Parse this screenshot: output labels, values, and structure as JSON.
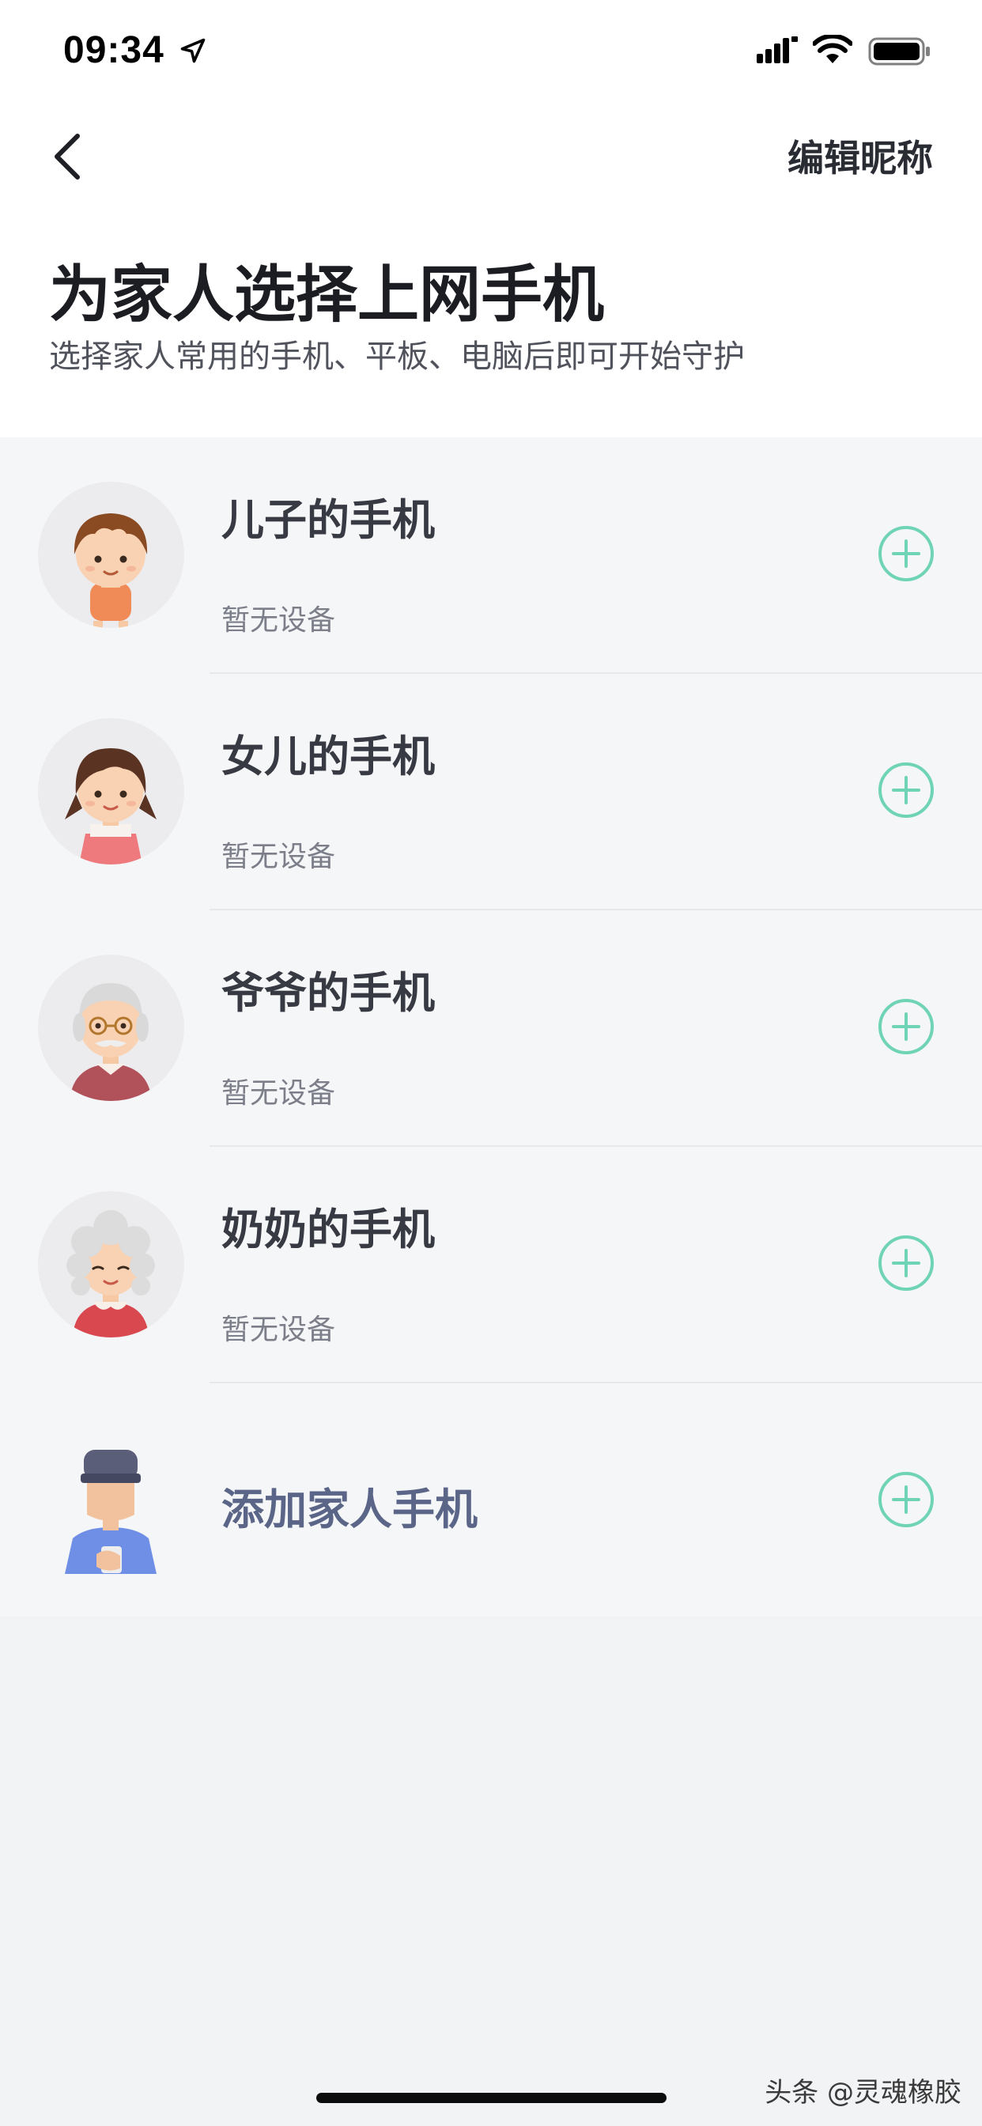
{
  "status_bar": {
    "time": "09:34",
    "icons": [
      "location-arrow-icon",
      "cellular-signal-icon",
      "wifi-icon",
      "battery-icon"
    ]
  },
  "nav": {
    "back_icon": "chevron-left-icon",
    "edit_label": "编辑昵称"
  },
  "header": {
    "title": "为家人选择上网手机",
    "subtitle": "选择家人常用的手机、平板、电脑后即可开始守护"
  },
  "family_list": [
    {
      "name": "儿子的手机",
      "status": "暂无设备",
      "avatar": "boy-avatar"
    },
    {
      "name": "女儿的手机",
      "status": "暂无设备",
      "avatar": "girl-avatar"
    },
    {
      "name": "爷爷的手机",
      "status": "暂无设备",
      "avatar": "grandpa-avatar"
    },
    {
      "name": "奶奶的手机",
      "status": "暂无设备",
      "avatar": "grandma-avatar"
    }
  ],
  "add_member": {
    "label": "添加家人手机",
    "avatar": "man-with-cap-avatar"
  },
  "watermark": "头条 @灵魂橡胶",
  "colors": {
    "accent": "#6fd3b5",
    "title_text": "#1c1d22",
    "list_bg": "#f5f6f8",
    "add_text": "#5b6587"
  }
}
